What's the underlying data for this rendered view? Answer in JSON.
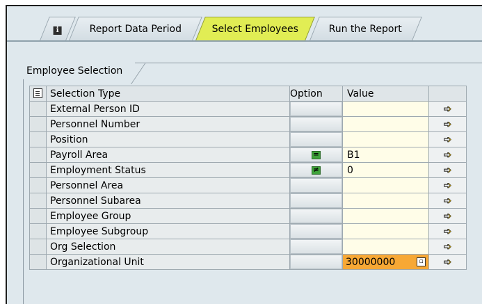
{
  "tabs": [
    {
      "id": "info",
      "label": "",
      "icon": "info-icon"
    },
    {
      "id": "period",
      "label": "Report Data Period"
    },
    {
      "id": "select",
      "label": "Select Employees",
      "active": true
    },
    {
      "id": "run",
      "label": "Run the Report"
    }
  ],
  "group": {
    "title": "Employee Selection"
  },
  "table": {
    "headers": {
      "selection_type": "Selection Type",
      "option": "Option",
      "value": "Value"
    },
    "rows": [
      {
        "type": "External Person ID",
        "option": "",
        "value": ""
      },
      {
        "type": "Personnel Number",
        "option": "",
        "value": ""
      },
      {
        "type": "Position",
        "option": "",
        "value": ""
      },
      {
        "type": "Payroll Area",
        "option": "=",
        "value": "B1"
      },
      {
        "type": "Employment Status",
        "option": "≠",
        "value": "0"
      },
      {
        "type": "Personnel Area",
        "option": "",
        "value": ""
      },
      {
        "type": "Personnel Subarea",
        "option": "",
        "value": ""
      },
      {
        "type": "Employee Group",
        "option": "",
        "value": ""
      },
      {
        "type": "Employee Subgroup",
        "option": "",
        "value": ""
      },
      {
        "type": "Org Selection",
        "option": "",
        "value": ""
      },
      {
        "type": "Organizational Unit",
        "option": "",
        "value": "30000000"
      }
    ]
  },
  "colors": {
    "active_tab": "#e1ed54",
    "value_bg": "#fffde8",
    "focus_field": "#f7a835"
  }
}
